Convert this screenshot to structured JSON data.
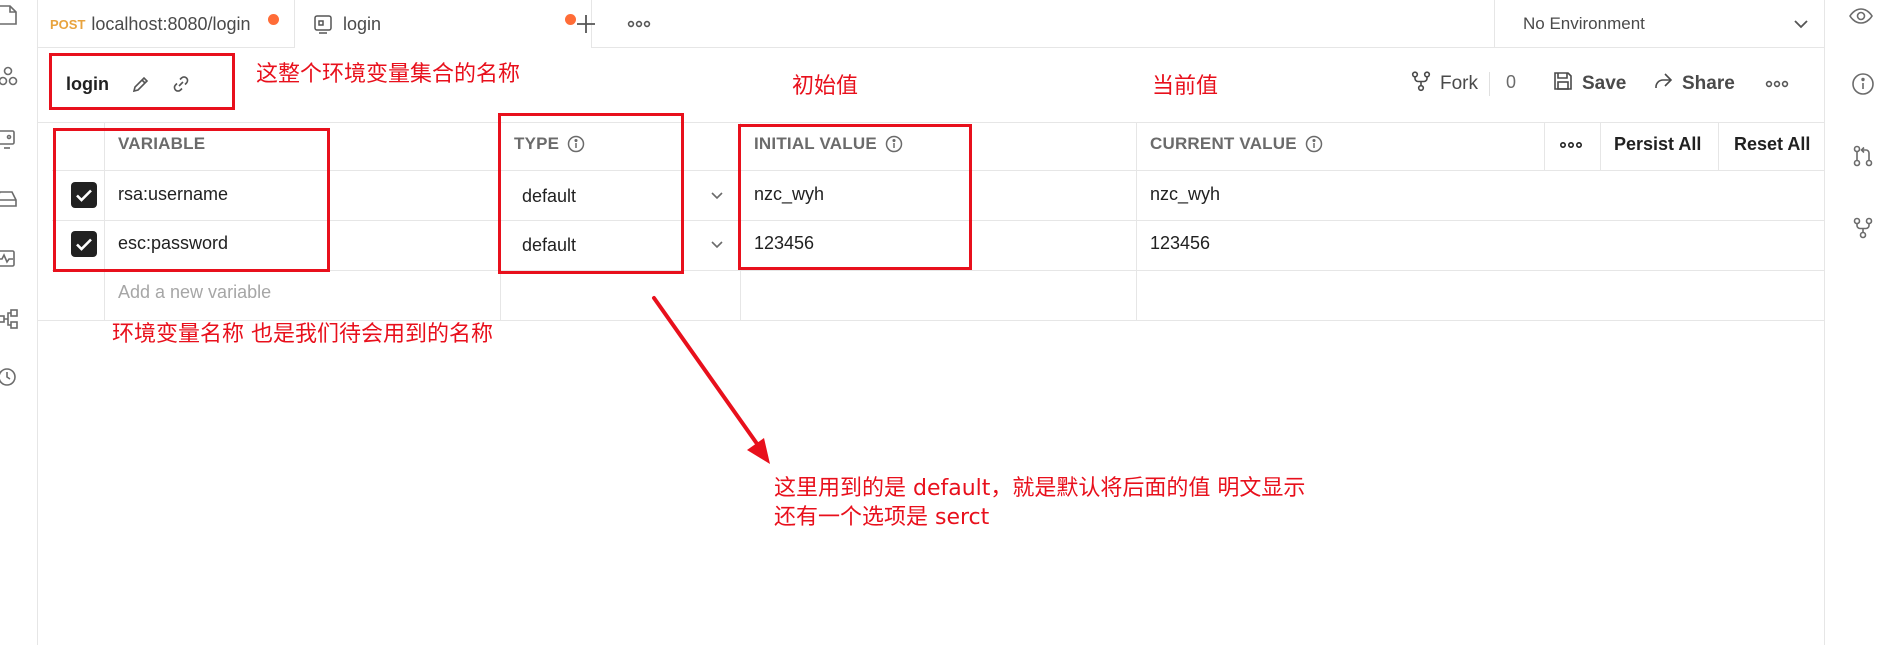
{
  "tabs": [
    {
      "method": "POST",
      "label": "localhost:8080/login"
    },
    {
      "label": "login"
    }
  ],
  "environment_selector": {
    "value": "No Environment"
  },
  "environment": {
    "name": "login"
  },
  "header_actions": {
    "fork_label": "Fork",
    "fork_count": "0",
    "save_label": "Save",
    "share_label": "Share"
  },
  "table": {
    "columns": {
      "variable": "VARIABLE",
      "type": "TYPE",
      "initial_value": "INITIAL VALUE",
      "current_value": "CURRENT VALUE"
    },
    "persist_all": "Persist All",
    "reset_all": "Reset All",
    "rows": [
      {
        "checked": true,
        "variable": "rsa:username",
        "type": "default",
        "initial": "nzc_wyh",
        "current": "nzc_wyh"
      },
      {
        "checked": true,
        "variable": "esc:password",
        "type": "default",
        "initial": "123456",
        "current": "123456"
      }
    ],
    "add_placeholder": "Add a new variable"
  },
  "annotations": {
    "env_set_name": "这整个环境变量集合的名称",
    "initial_value": "初始值",
    "current_value": "当前值",
    "variable_name": "环境变量名称 也是我们待会用到的名称",
    "type_line1": "这里用到的是 default，就是默认将后面的值 明文显示",
    "type_line2": "还有一个选项是 serct"
  },
  "colors": {
    "annotation_red": "#e8101c",
    "unsaved_dot": "#ff6c37",
    "method_post": "#e8a33d"
  },
  "icons": {
    "left_sidebar": [
      "collections-icon",
      "apis-icon",
      "environments-icon",
      "mock-servers-icon",
      "monitors-icon",
      "flows-icon",
      "history-icon"
    ],
    "right_sidebar": [
      "info-icon",
      "pull-request-icon",
      "fork-icon"
    ]
  }
}
